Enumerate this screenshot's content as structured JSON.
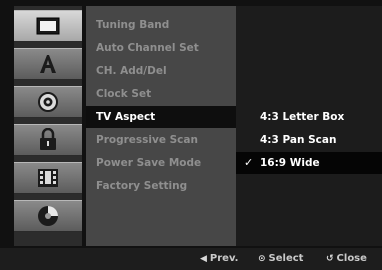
{
  "sidebar": {
    "icons": [
      {
        "name": "display-icon"
      },
      {
        "name": "language-icon"
      },
      {
        "name": "audio-icon"
      },
      {
        "name": "lock-icon"
      },
      {
        "name": "recording-icon"
      },
      {
        "name": "disc-icon"
      }
    ],
    "active_index": 0
  },
  "menu": {
    "items": [
      "Tuning Band",
      "Auto Channel Set",
      "CH. Add/Del",
      "Clock Set",
      "TV Aspect",
      "Progressive Scan",
      "Power Save Mode",
      "Factory Setting"
    ],
    "active_index": 4
  },
  "submenu": {
    "options": [
      "4:3 Letter Box",
      "4:3 Pan Scan",
      "16:9 Wide"
    ],
    "selected_index": 2,
    "check_mark": "✓"
  },
  "hints": {
    "prev_glyph": "◀",
    "prev_label": "Prev.",
    "select_glyph": "⊙",
    "select_label": "Select",
    "close_glyph": "↺",
    "close_label": "Close"
  },
  "colors": {
    "active_tab": "#c8c8c8",
    "inactive_text": "#8f8f8f",
    "active_text": "#ffffff"
  }
}
